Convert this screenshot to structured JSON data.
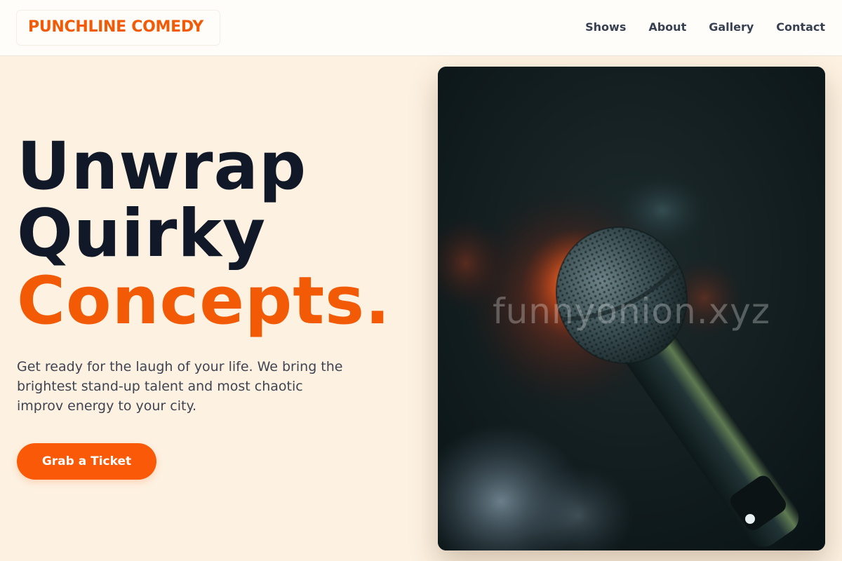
{
  "brand": {
    "name": "PUNCHLINE COMEDY",
    "accent_color": "#f25a06"
  },
  "nav": {
    "items": [
      {
        "label": "Shows"
      },
      {
        "label": "About"
      },
      {
        "label": "Gallery"
      },
      {
        "label": "Contact"
      }
    ]
  },
  "hero": {
    "title_line1": "Unwrap",
    "title_line2": "Quirky",
    "title_line3": "Concepts.",
    "description": "Get ready for the laugh of your life. We bring the brightest stand-up talent and most chaotic improv energy to your city.",
    "cta_label": "Grab a Ticket"
  },
  "image": {
    "subject": "microphone-photo",
    "watermark": "funnyonion.xyz"
  }
}
